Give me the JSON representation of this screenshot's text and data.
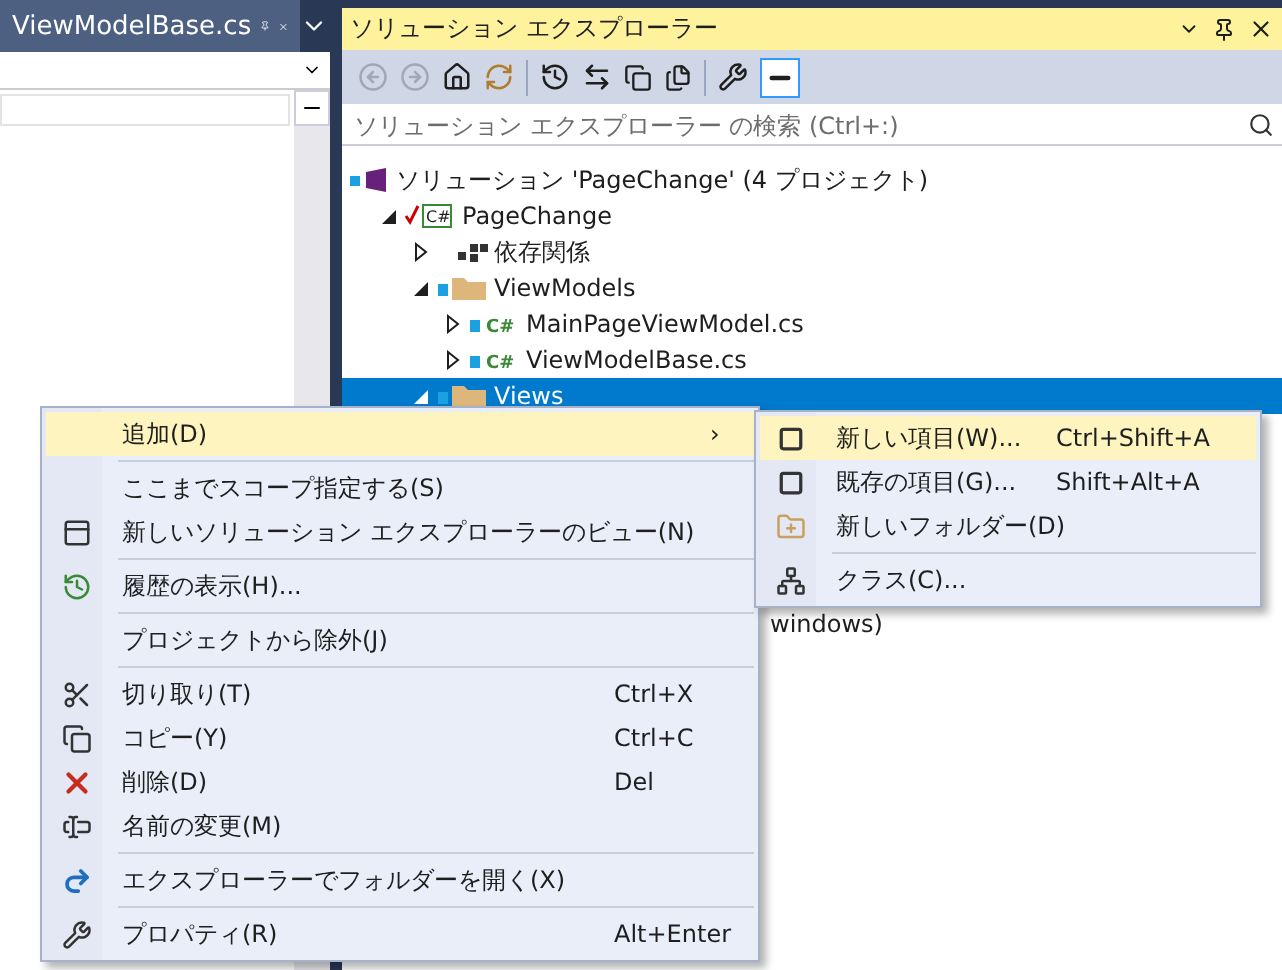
{
  "editor": {
    "tab": {
      "title": "ViewModelBase.cs",
      "selected": true
    }
  },
  "explorer": {
    "title": "ソリューション エクスプローラー",
    "search": {
      "placeholder": "ソリューション エクスプローラー の検索 (Ctrl+:)"
    },
    "tree": [
      {
        "label": "ソリューション 'PageChange' (4 プロジェクト)",
        "kind": "solution",
        "selected": false,
        "children": [
          {
            "label": "PageChange",
            "kind": "project",
            "icon_text": "C#",
            "expanded": true,
            "selected": false,
            "children": [
              {
                "label": "依存関係",
                "kind": "deps",
                "expanded": false,
                "selected": false
              },
              {
                "label": "ViewModels",
                "kind": "folder",
                "expanded": true,
                "selected": false,
                "children": [
                  {
                    "label": "MainPageViewModel.cs",
                    "kind": "csfile",
                    "icon_text": "C#",
                    "expanded": false,
                    "selected": false
                  },
                  {
                    "label": "ViewModelBase.cs",
                    "kind": "csfile",
                    "icon_text": "C#",
                    "expanded": false,
                    "selected": false
                  }
                ]
              },
              {
                "label": "Views",
                "kind": "folder",
                "expanded": true,
                "selected": true
              }
            ]
          }
        ]
      }
    ],
    "behind_text": "windows)"
  },
  "context_menu": {
    "items": [
      {
        "label": "追加(D)",
        "kind": "blank",
        "selected": true,
        "submenu_arrow": "›",
        "separator_before": false
      },
      {
        "label": "ここまでスコープ指定する(S)",
        "kind": "blank",
        "selected": false,
        "separator_before": true
      },
      {
        "label": "新しいソリューション エクスプローラーのビュー(N)",
        "kind": "newview",
        "selected": false,
        "separator_before": false
      },
      {
        "label": "履歴の表示(H)...",
        "kind": "history",
        "selected": false,
        "separator_before": true
      },
      {
        "label": "プロジェクトから除外(J)",
        "kind": "blank",
        "selected": false,
        "separator_before": true
      },
      {
        "label": "切り取り(T)",
        "shortcut": "Ctrl+X",
        "kind": "cut",
        "selected": false,
        "separator_before": true
      },
      {
        "label": "コピー(Y)",
        "shortcut": "Ctrl+C",
        "kind": "copy",
        "selected": false,
        "separator_before": false
      },
      {
        "label": "削除(D)",
        "shortcut": "Del",
        "kind": "delete",
        "selected": false,
        "separator_before": false
      },
      {
        "label": "名前の変更(M)",
        "kind": "rename",
        "selected": false,
        "separator_before": false
      },
      {
        "label": "エクスプローラーでフォルダーを開く(X)",
        "kind": "open",
        "selected": false,
        "separator_before": true
      },
      {
        "label": "プロパティ(R)",
        "shortcut": "Alt+Enter",
        "kind": "properties",
        "selected": false,
        "separator_before": true
      }
    ]
  },
  "submenu": {
    "items": [
      {
        "label": "新しい項目(W)...",
        "shortcut": "Ctrl+Shift+A",
        "kind": "newitem",
        "selected": true,
        "separator_before": false
      },
      {
        "label": "既存の項目(G)...",
        "shortcut": "Shift+Alt+A",
        "kind": "existing",
        "selected": false,
        "separator_before": false
      },
      {
        "label": "新しいフォルダー(D)",
        "kind": "newfolder",
        "selected": false,
        "separator_before": false
      },
      {
        "label": "クラス(C)...",
        "kind": "class",
        "selected": false,
        "separator_before": true
      }
    ]
  }
}
